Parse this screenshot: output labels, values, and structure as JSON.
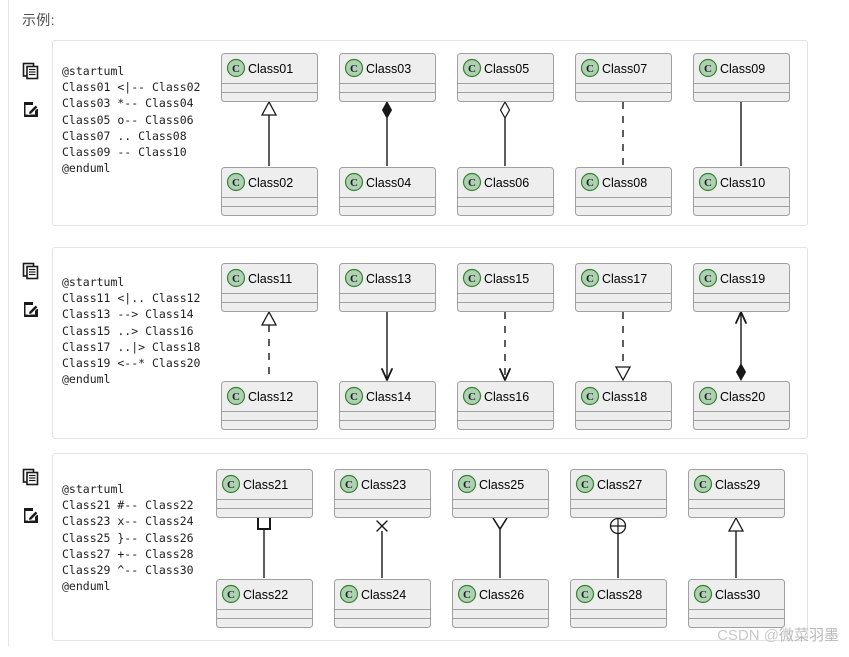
{
  "page": {
    "heading": "示例:",
    "watermark_prefix": "CSDN @",
    "watermark_author": "微菜羽墨"
  },
  "icons": {
    "copy": "copy-icon",
    "edit": "edit-icon"
  },
  "colors": {
    "class_fill": "#EEEEEE",
    "class_border": "#A0A0A0",
    "circle_fill": "#ADD1B2",
    "circle_border": "#38812F",
    "line": "#181818",
    "card_border": "#E3E3E3",
    "watermark": "#C9C9C9"
  },
  "blocks": [
    {
      "id": "block-1",
      "code": "@startuml\nClass01 <|-- Class02\nClass03 *-- Class04\nClass05 o-- Class06\nClass07 .. Class08\nClass09 -- Class10\n@enduml",
      "pairs": [
        {
          "top": "Class01",
          "bottom": "Class02",
          "relation": "<|--",
          "line": "solid",
          "top_marker": "hollow-triangle",
          "bottom_marker": "none"
        },
        {
          "top": "Class03",
          "bottom": "Class04",
          "relation": "*--",
          "line": "solid",
          "top_marker": "filled-diamond",
          "bottom_marker": "none"
        },
        {
          "top": "Class05",
          "bottom": "Class06",
          "relation": "o--",
          "line": "solid",
          "top_marker": "hollow-diamond",
          "bottom_marker": "none"
        },
        {
          "top": "Class07",
          "bottom": "Class08",
          "relation": "..",
          "line": "dashed",
          "top_marker": "none",
          "bottom_marker": "none"
        },
        {
          "top": "Class09",
          "bottom": "Class10",
          "relation": "--",
          "line": "solid",
          "top_marker": "none",
          "bottom_marker": "none"
        }
      ]
    },
    {
      "id": "block-2",
      "code": "@startuml\nClass11 <|.. Class12\nClass13 --> Class14\nClass15 ..> Class16\nClass17 ..|> Class18\nClass19 <--* Class20\n@enduml",
      "pairs": [
        {
          "top": "Class11",
          "bottom": "Class12",
          "relation": "<|..",
          "line": "dashed",
          "top_marker": "hollow-triangle",
          "bottom_marker": "none"
        },
        {
          "top": "Class13",
          "bottom": "Class14",
          "relation": "-->",
          "line": "solid",
          "top_marker": "none",
          "bottom_marker": "open-arrow-down"
        },
        {
          "top": "Class15",
          "bottom": "Class16",
          "relation": "..>",
          "line": "dashed",
          "top_marker": "none",
          "bottom_marker": "open-arrow-down"
        },
        {
          "top": "Class17",
          "bottom": "Class18",
          "relation": "..|>",
          "line": "dashed",
          "top_marker": "none",
          "bottom_marker": "hollow-triangle-down"
        },
        {
          "top": "Class19",
          "bottom": "Class20",
          "relation": "<--*",
          "line": "solid",
          "top_marker": "open-arrow-up",
          "bottom_marker": "filled-diamond-up"
        }
      ]
    },
    {
      "id": "block-3",
      "code": "@startuml\nClass21 #-- Class22\nClass23 x-- Class24\nClass25 }-- Class26\nClass27 +-- Class28\nClass29 ^-- Class30\n@enduml",
      "pairs": [
        {
          "top": "Class21",
          "bottom": "Class22",
          "relation": "#--",
          "line": "solid",
          "top_marker": "square",
          "bottom_marker": "none"
        },
        {
          "top": "Class23",
          "bottom": "Class24",
          "relation": "x--",
          "line": "solid",
          "top_marker": "cross",
          "bottom_marker": "none"
        },
        {
          "top": "Class25",
          "bottom": "Class26",
          "relation": "}--",
          "line": "solid",
          "top_marker": "crowfoot",
          "bottom_marker": "none"
        },
        {
          "top": "Class27",
          "bottom": "Class28",
          "relation": "+--",
          "line": "solid",
          "top_marker": "circle-plus",
          "bottom_marker": "none"
        },
        {
          "top": "Class29",
          "bottom": "Class30",
          "relation": "^--",
          "line": "solid",
          "top_marker": "hollow-triangle",
          "bottom_marker": "none"
        }
      ]
    }
  ]
}
